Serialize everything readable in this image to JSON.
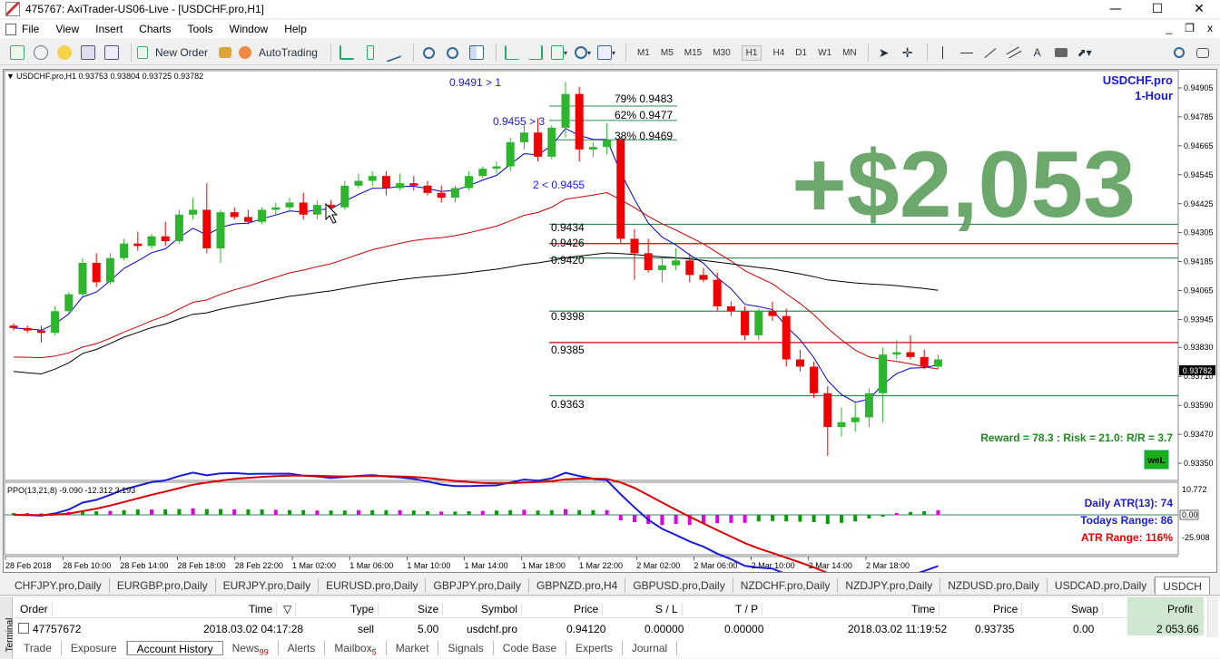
{
  "window": {
    "title": "475767: AxiTrader-US06-Live - [USDCHF.pro,H1]",
    "minimize_glyph": "—",
    "maximize_glyph": "☐",
    "close_glyph": "✕"
  },
  "menu": {
    "items": [
      "File",
      "View",
      "Insert",
      "Charts",
      "Tools",
      "Window",
      "Help"
    ],
    "child_min": "_",
    "child_restore": "❐",
    "child_close": "x"
  },
  "toolbar": {
    "new_order": "New Order",
    "autotrading": "AutoTrading",
    "timeframes": [
      "M1",
      "M5",
      "M15",
      "M30",
      "H1",
      "H4",
      "D1",
      "W1",
      "MN"
    ],
    "active_timeframe": "H1",
    "text_tool": "A"
  },
  "chart": {
    "header": "USDCHF.pro,H1  0.93753 0.93804 0.93725 0.93782",
    "symbol_label": "USDCHF.pro",
    "period_label": "1-Hour",
    "profit_overlay": "+$2,053",
    "reward_risk": "Reward = 78.3 : Risk = 21.0: R/R = 3.7",
    "logo_text": "weL",
    "current_price": "0.93782",
    "annotations": {
      "signal1": "0.9491 > 1",
      "signal2": "0.9455 > 3",
      "signal3": "2 < 0.9455"
    },
    "fib_labels": [
      "79% 0.9483",
      "62% 0.9477",
      "38% 0.9469"
    ],
    "level_labels": [
      "0.9434",
      "0.9426",
      "0.9420",
      "0.9398",
      "0.9385",
      "0.9363"
    ],
    "price_ticks": [
      "0.94905",
      "0.94785",
      "0.94665",
      "0.94545",
      "0.94425",
      "0.94305",
      "0.94185",
      "0.94065",
      "0.93945",
      "0.93830",
      "0.93710",
      "0.93590",
      "0.93470",
      "0.93350"
    ],
    "time_ticks": [
      "28 Feb 2018",
      "28 Feb 10:00",
      "28 Feb 14:00",
      "28 Feb 18:00",
      "28 Feb 22:00",
      "1 Mar 02:00",
      "1 Mar 06:00",
      "1 Mar 10:00",
      "1 Mar 14:00",
      "1 Mar 18:00",
      "1 Mar 22:00",
      "2 Mar 02:00",
      "2 Mar 06:00",
      "2 Mar 10:00",
      "2 Mar 14:00",
      "2 Mar 18:00"
    ],
    "colors": {
      "bull": "#2db52d",
      "bear": "#ee0000",
      "profit": "#5f9f5f",
      "blue_label": "#1a1adb",
      "green_text": "#1d8a1d"
    }
  },
  "indicator": {
    "header": "PPO(13,21,8) -9.090 -12.312 3.193",
    "ticks": [
      "10.772",
      "0.00",
      "-25.908"
    ],
    "daily_atr": "Daily ATR(13): 74",
    "todays_range": "Todays Range: 86",
    "atr_range": "ATR Range: 116%"
  },
  "chart_data": {
    "type": "candlestick",
    "ylim": [
      0.9329,
      0.9495
    ],
    "candles": [
      [
        0.9392,
        0.9393,
        0.939,
        0.9391
      ],
      [
        0.9391,
        0.9392,
        0.9389,
        0.939
      ],
      [
        0.939,
        0.9392,
        0.9385,
        0.9389
      ],
      [
        0.9389,
        0.94,
        0.9388,
        0.9398
      ],
      [
        0.9398,
        0.9406,
        0.9397,
        0.9405
      ],
      [
        0.9405,
        0.942,
        0.9404,
        0.9418
      ],
      [
        0.9418,
        0.9422,
        0.9408,
        0.941
      ],
      [
        0.941,
        0.9422,
        0.9409,
        0.942
      ],
      [
        0.942,
        0.9428,
        0.9419,
        0.9426
      ],
      [
        0.9426,
        0.9431,
        0.9423,
        0.9425
      ],
      [
        0.9425,
        0.943,
        0.9424,
        0.9429
      ],
      [
        0.9429,
        0.9435,
        0.9425,
        0.9427
      ],
      [
        0.9427,
        0.944,
        0.9426,
        0.9438
      ],
      [
        0.9438,
        0.9445,
        0.9436,
        0.944
      ],
      [
        0.944,
        0.9451,
        0.9422,
        0.9424
      ],
      [
        0.9424,
        0.944,
        0.9418,
        0.9439
      ],
      [
        0.9439,
        0.9441,
        0.9436,
        0.9437
      ],
      [
        0.9437,
        0.944,
        0.9434,
        0.9435
      ],
      [
        0.9435,
        0.9441,
        0.9434,
        0.944
      ],
      [
        0.944,
        0.9443,
        0.9438,
        0.9441
      ],
      [
        0.9441,
        0.9445,
        0.9439,
        0.9443
      ],
      [
        0.9443,
        0.9447,
        0.9436,
        0.9438
      ],
      [
        0.9438,
        0.9444,
        0.9436,
        0.9442
      ],
      [
        0.9442,
        0.9444,
        0.944,
        0.9441
      ],
      [
        0.9441,
        0.9452,
        0.944,
        0.945
      ],
      [
        0.945,
        0.9455,
        0.9449,
        0.9452
      ],
      [
        0.9452,
        0.9456,
        0.945,
        0.9454
      ],
      [
        0.9454,
        0.9456,
        0.9446,
        0.9449
      ],
      [
        0.9449,
        0.9455,
        0.9448,
        0.9451
      ],
      [
        0.9451,
        0.9454,
        0.9448,
        0.945
      ],
      [
        0.945,
        0.9452,
        0.9446,
        0.9447
      ],
      [
        0.9447,
        0.945,
        0.9443,
        0.9445
      ],
      [
        0.9445,
        0.945,
        0.9443,
        0.9449
      ],
      [
        0.9449,
        0.9456,
        0.9448,
        0.9454
      ],
      [
        0.9454,
        0.9458,
        0.9453,
        0.9457
      ],
      [
        0.9457,
        0.946,
        0.9455,
        0.9458
      ],
      [
        0.9458,
        0.947,
        0.9456,
        0.9468
      ],
      [
        0.9468,
        0.9475,
        0.9465,
        0.9472
      ],
      [
        0.9472,
        0.9478,
        0.946,
        0.9462
      ],
      [
        0.9462,
        0.9475,
        0.9461,
        0.9474
      ],
      [
        0.9474,
        0.9493,
        0.947,
        0.9488
      ],
      [
        0.9488,
        0.9491,
        0.946,
        0.9465
      ],
      [
        0.9465,
        0.9468,
        0.9462,
        0.9466
      ],
      [
        0.9466,
        0.9476,
        0.9463,
        0.9469
      ],
      [
        0.9469,
        0.947,
        0.9426,
        0.9428
      ],
      [
        0.9428,
        0.9432,
        0.9411,
        0.9422
      ],
      [
        0.9422,
        0.9428,
        0.9414,
        0.9415
      ],
      [
        0.9415,
        0.942,
        0.941,
        0.9417
      ],
      [
        0.9417,
        0.9424,
        0.9415,
        0.9419
      ],
      [
        0.9419,
        0.9422,
        0.941,
        0.9413
      ],
      [
        0.9413,
        0.9416,
        0.941,
        0.9411
      ],
      [
        0.9411,
        0.9414,
        0.9398,
        0.94
      ],
      [
        0.94,
        0.9402,
        0.9396,
        0.9398
      ],
      [
        0.9398,
        0.94,
        0.9386,
        0.9388
      ],
      [
        0.9388,
        0.9399,
        0.9386,
        0.9398
      ],
      [
        0.9398,
        0.9402,
        0.9394,
        0.9396
      ],
      [
        0.9396,
        0.9399,
        0.9375,
        0.9378
      ],
      [
        0.9378,
        0.9382,
        0.9373,
        0.9375
      ],
      [
        0.9375,
        0.9377,
        0.9362,
        0.9364
      ],
      [
        0.9364,
        0.9367,
        0.9338,
        0.935
      ],
      [
        0.935,
        0.9358,
        0.9346,
        0.9352
      ],
      [
        0.9352,
        0.936,
        0.9348,
        0.9354
      ],
      [
        0.9354,
        0.9366,
        0.935,
        0.9364
      ],
      [
        0.9364,
        0.9383,
        0.9352,
        0.938
      ],
      [
        0.938,
        0.9386,
        0.9378,
        0.9381
      ],
      [
        0.9381,
        0.9388,
        0.9378,
        0.9379
      ],
      [
        0.9379,
        0.9382,
        0.9374,
        0.9375
      ],
      [
        0.9375,
        0.938,
        0.9374,
        0.9378
      ]
    ],
    "ppo_hist": [
      0.5,
      0.5,
      0.4,
      0.6,
      0.8,
      1.0,
      1.0,
      1.1,
      1.3,
      1.5,
      1.5,
      1.5,
      1.6,
      1.8,
      1.6,
      1.6,
      1.5,
      1.5,
      1.5,
      1.4,
      1.3,
      1.3,
      1.2,
      1.2,
      1.2,
      1.3,
      1.3,
      1.3,
      1.3,
      1.2,
      1.0,
      0.9,
      0.9,
      1.0,
      1.1,
      1.2,
      1.3,
      1.4,
      1.2,
      1.3,
      1.6,
      1.3,
      1.3,
      1.3,
      -1.5,
      -2.0,
      -2.5,
      -2.8,
      -2.5,
      -2.8,
      -2.5,
      -2.3,
      -2.2,
      -2.2,
      -1.8,
      -1.7,
      -1.8,
      -1.9,
      -2.0,
      -2.5,
      -2.2,
      -1.8,
      -1.0,
      -0.5,
      0.5,
      0.8,
      1.0,
      1.3
    ]
  },
  "symbol_tabs": [
    "CHFJPY.pro,Daily",
    "EURGBP.pro,Daily",
    "EURJPY.pro,Daily",
    "EURUSD.pro,Daily",
    "GBPJPY.pro,Daily",
    "GBPNZD.pro,H4",
    "GBPUSD.pro,Daily",
    "NZDCHF.pro,Daily",
    "NZDJPY.pro,Daily",
    "NZDUSD.pro,Daily",
    "USDCAD.pro,Daily",
    "USDCH"
  ],
  "terminal": {
    "side_label": "Terminal",
    "close": "×",
    "columns": [
      "Order",
      "Time",
      "Type",
      "Size",
      "Symbol",
      "Price",
      "S / L",
      "T / P",
      "Time",
      "Price",
      "Swap",
      "Profit"
    ],
    "sort_glyph": "▽",
    "row": [
      "47757672",
      "2018.03.02 04:17:28",
      "sell",
      "5.00",
      "usdchf.pro",
      "0.94120",
      "0.00000",
      "0.00000",
      "2018.03.02 11:19:52",
      "0.93735",
      "0.00",
      "2 053.66"
    ],
    "bottom_tabs": [
      "Trade",
      "Exposure",
      "Account History",
      "News",
      "Alerts",
      "Mailbox",
      "Market",
      "Signals",
      "Code Base",
      "Experts",
      "Journal"
    ],
    "news_badge": "99",
    "mailbox_badge": "5",
    "active_tab": "Account History"
  }
}
